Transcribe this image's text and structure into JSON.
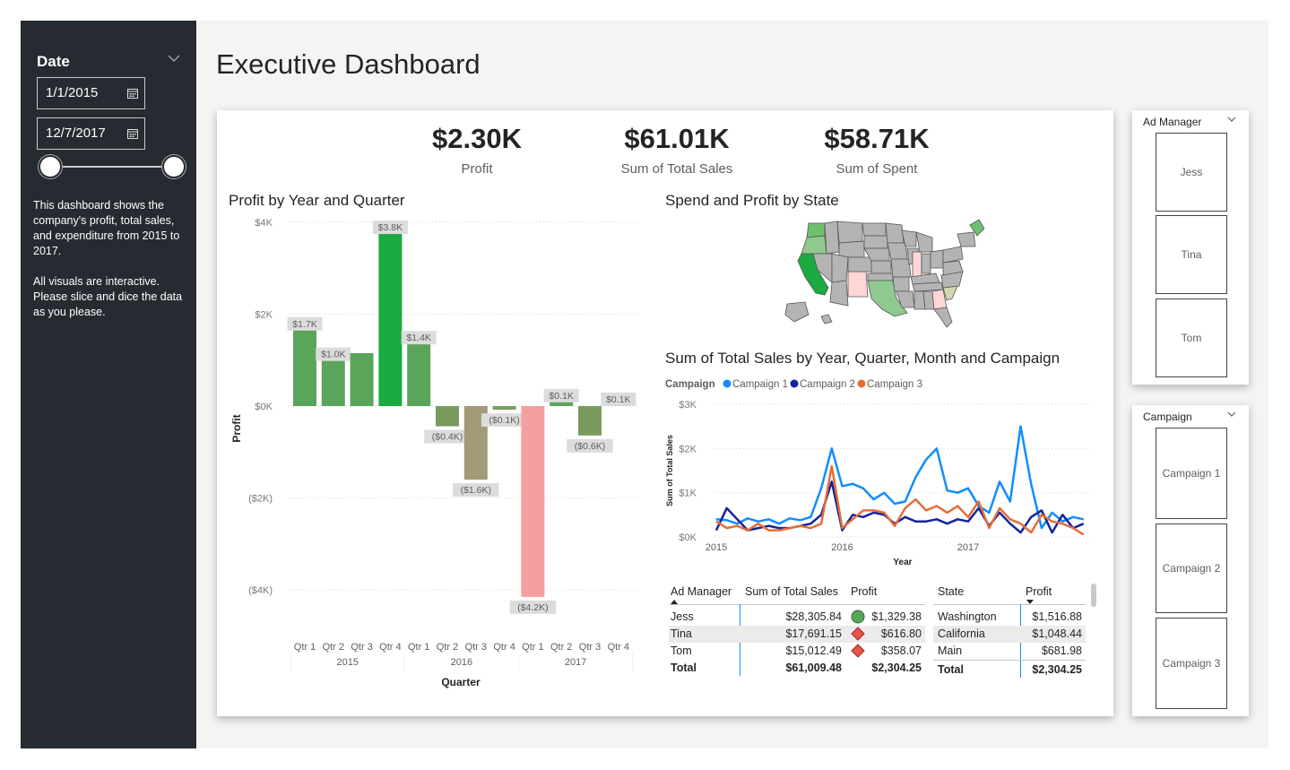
{
  "title": "Executive Dashboard",
  "date_slicer": {
    "label": "Date",
    "start": "1/1/2015",
    "end": "12/7/2017",
    "icon_dropdown": "chevron-down-icon",
    "icon_calendar": "calendar-icon"
  },
  "description": {
    "p1": "This dashboard shows the company's profit, total sales, and expenditure from 2015 to 2017.",
    "p2": "All visuals are interactive. Please slice and dice the data as you please."
  },
  "kpis": [
    {
      "value": "$2.30K",
      "label": "Profit"
    },
    {
      "value": "$61.01K",
      "label": "Sum of Total Sales"
    },
    {
      "value": "$58.71K",
      "label": "Sum of Spent"
    }
  ],
  "profit_chart": {
    "title": "Profit by Year and Quarter",
    "y_label": "Profit",
    "x_label": "Quarter"
  },
  "map": {
    "title": "Spend and Profit by State"
  },
  "sales_chart": {
    "title": "Sum of Total Sales by Year, Quarter, Month and Campaign",
    "legend_title": "Campaign",
    "y_label": "Sum of Total Sales",
    "x_label": "Year"
  },
  "manager_table": {
    "headers": [
      "Ad Manager",
      "Sum of Total Sales",
      "Profit"
    ],
    "rows": [
      {
        "name": "Jess",
        "sales": "$28,305.84",
        "profit": "$1,329.38",
        "indicator": "green-circle-icon"
      },
      {
        "name": "Tina",
        "sales": "$17,691.15",
        "profit": "$616.80",
        "indicator": "red-diamond-icon"
      },
      {
        "name": "Tom",
        "sales": "$15,012.49",
        "profit": "$358.07",
        "indicator": "red-diamond-icon"
      }
    ],
    "total": {
      "name": "Total",
      "sales": "$61,009.48",
      "profit": "$2,304.25"
    }
  },
  "state_table": {
    "headers": [
      "State",
      "Profit"
    ],
    "rows": [
      {
        "name": "Washington",
        "profit": "$1,516.88"
      },
      {
        "name": "California",
        "profit": "$1,048.44"
      },
      {
        "name": "Main",
        "profit": "$681.98"
      }
    ],
    "total": {
      "name": "Total",
      "profit": "$2,304.25"
    }
  },
  "ad_manager_slicer": {
    "title": "Ad Manager",
    "items": [
      "Jess",
      "Tina",
      "Tom"
    ]
  },
  "campaign_slicer": {
    "title": "Campaign",
    "items": [
      "Campaign 1",
      "Campaign 2",
      "Campaign 3"
    ]
  },
  "colors": {
    "sidebar_bg": "#252b31",
    "campaign1": "#118dff",
    "campaign2": "#12239e",
    "campaign3": "#e66c37",
    "profit_high": "#1aab40",
    "profit_pos": "#5aa55a",
    "profit_neg": "#a39a77",
    "profit_low": "#f4a0a0"
  },
  "chart_data": [
    {
      "type": "bar",
      "title": "Profit by Year and Quarter",
      "xlabel": "Quarter",
      "ylabel": "Profit",
      "categories": [
        "2015 Qtr 1",
        "2015 Qtr 2",
        "2015 Qtr 3",
        "2015 Qtr 4",
        "2016 Qtr 1",
        "2016 Qtr 2",
        "2016 Qtr 3",
        "2016 Qtr 4",
        "2017 Qtr 1",
        "2017 Qtr 2",
        "2017 Qtr 3",
        "2017 Qtr 4"
      ],
      "quarters": [
        "Qtr 1",
        "Qtr 2",
        "Qtr 3",
        "Qtr 4"
      ],
      "years": [
        "2015",
        "2016",
        "2017"
      ],
      "values": [
        1700,
        1040,
        1150,
        3800,
        1400,
        -440,
        -1600,
        -80,
        -4150,
        140,
        -640,
        60
      ],
      "data_labels": [
        "$1.7K",
        "$1.0K",
        "",
        "$3.8K",
        "$1.4K",
        "($0.4K)",
        "($1.6K)",
        "($0.1K)",
        "($4.2K)",
        "$0.1K",
        "($0.6K)",
        "$0.1K"
      ],
      "bar_colors": [
        "#5aa55a",
        "#5aa55a",
        "#5aa55a",
        "#1aab40",
        "#5aa55a",
        "#7a9a60",
        "#a39a77",
        "#7aa060",
        "#f4a0a0",
        "#5aa55a",
        "#7a9a60",
        "#5aa55a"
      ],
      "y_ticks": [
        4000,
        2000,
        0,
        -2000,
        -4000
      ],
      "y_tick_labels": [
        "$4K",
        "$2K",
        "$0K",
        "($2K)",
        "($4K)"
      ],
      "ylim": [
        -5000,
        4200
      ],
      "grid": true
    },
    {
      "type": "line",
      "title": "Sum of Total Sales by Year, Quarter, Month and Campaign",
      "xlabel": "Year",
      "ylabel": "Sum of Total Sales",
      "x": [
        "2015-01",
        "2015-02",
        "2015-03",
        "2015-04",
        "2015-05",
        "2015-06",
        "2015-07",
        "2015-08",
        "2015-09",
        "2015-10",
        "2015-11",
        "2015-12",
        "2016-01",
        "2016-02",
        "2016-03",
        "2016-04",
        "2016-05",
        "2016-06",
        "2016-07",
        "2016-08",
        "2016-09",
        "2016-10",
        "2016-11",
        "2016-12",
        "2017-01",
        "2017-02",
        "2017-03",
        "2017-04",
        "2017-05",
        "2017-06",
        "2017-07",
        "2017-08",
        "2017-09",
        "2017-10",
        "2017-11",
        "2017-12"
      ],
      "x_tick_labels": [
        "2015",
        "2016",
        "2017"
      ],
      "y_ticks": [
        0,
        1000,
        2000,
        3000
      ],
      "y_tick_labels": [
        "$0K",
        "$1K",
        "$2K",
        "$3K"
      ],
      "ylim": [
        0,
        3000
      ],
      "legend_position": "top-left",
      "series": [
        {
          "name": "Campaign 1",
          "color": "#118dff",
          "values": [
            400,
            380,
            300,
            420,
            350,
            400,
            300,
            420,
            380,
            450,
            1100,
            2000,
            1150,
            1200,
            1100,
            850,
            1000,
            750,
            800,
            1350,
            1750,
            2000,
            1050,
            1000,
            1100,
            700,
            550,
            1250,
            800,
            2500,
            1200,
            200,
            550,
            350,
            450,
            400
          ]
        },
        {
          "name": "Campaign 2",
          "color": "#12239e",
          "values": [
            150,
            650,
            400,
            150,
            200,
            250,
            200,
            200,
            250,
            300,
            500,
            1250,
            150,
            500,
            450,
            550,
            500,
            300,
            450,
            350,
            350,
            400,
            300,
            400,
            350,
            650,
            250,
            550,
            300,
            100,
            450,
            600,
            100,
            500,
            200,
            300
          ]
        },
        {
          "name": "Campaign 3",
          "color": "#e66c37",
          "values": [
            350,
            200,
            250,
            150,
            300,
            150,
            150,
            200,
            250,
            200,
            300,
            1600,
            200,
            400,
            600,
            600,
            550,
            250,
            650,
            850,
            600,
            700,
            550,
            700,
            450,
            800,
            200,
            650,
            400,
            300,
            100,
            500,
            350,
            300,
            200,
            50
          ]
        }
      ]
    }
  ]
}
